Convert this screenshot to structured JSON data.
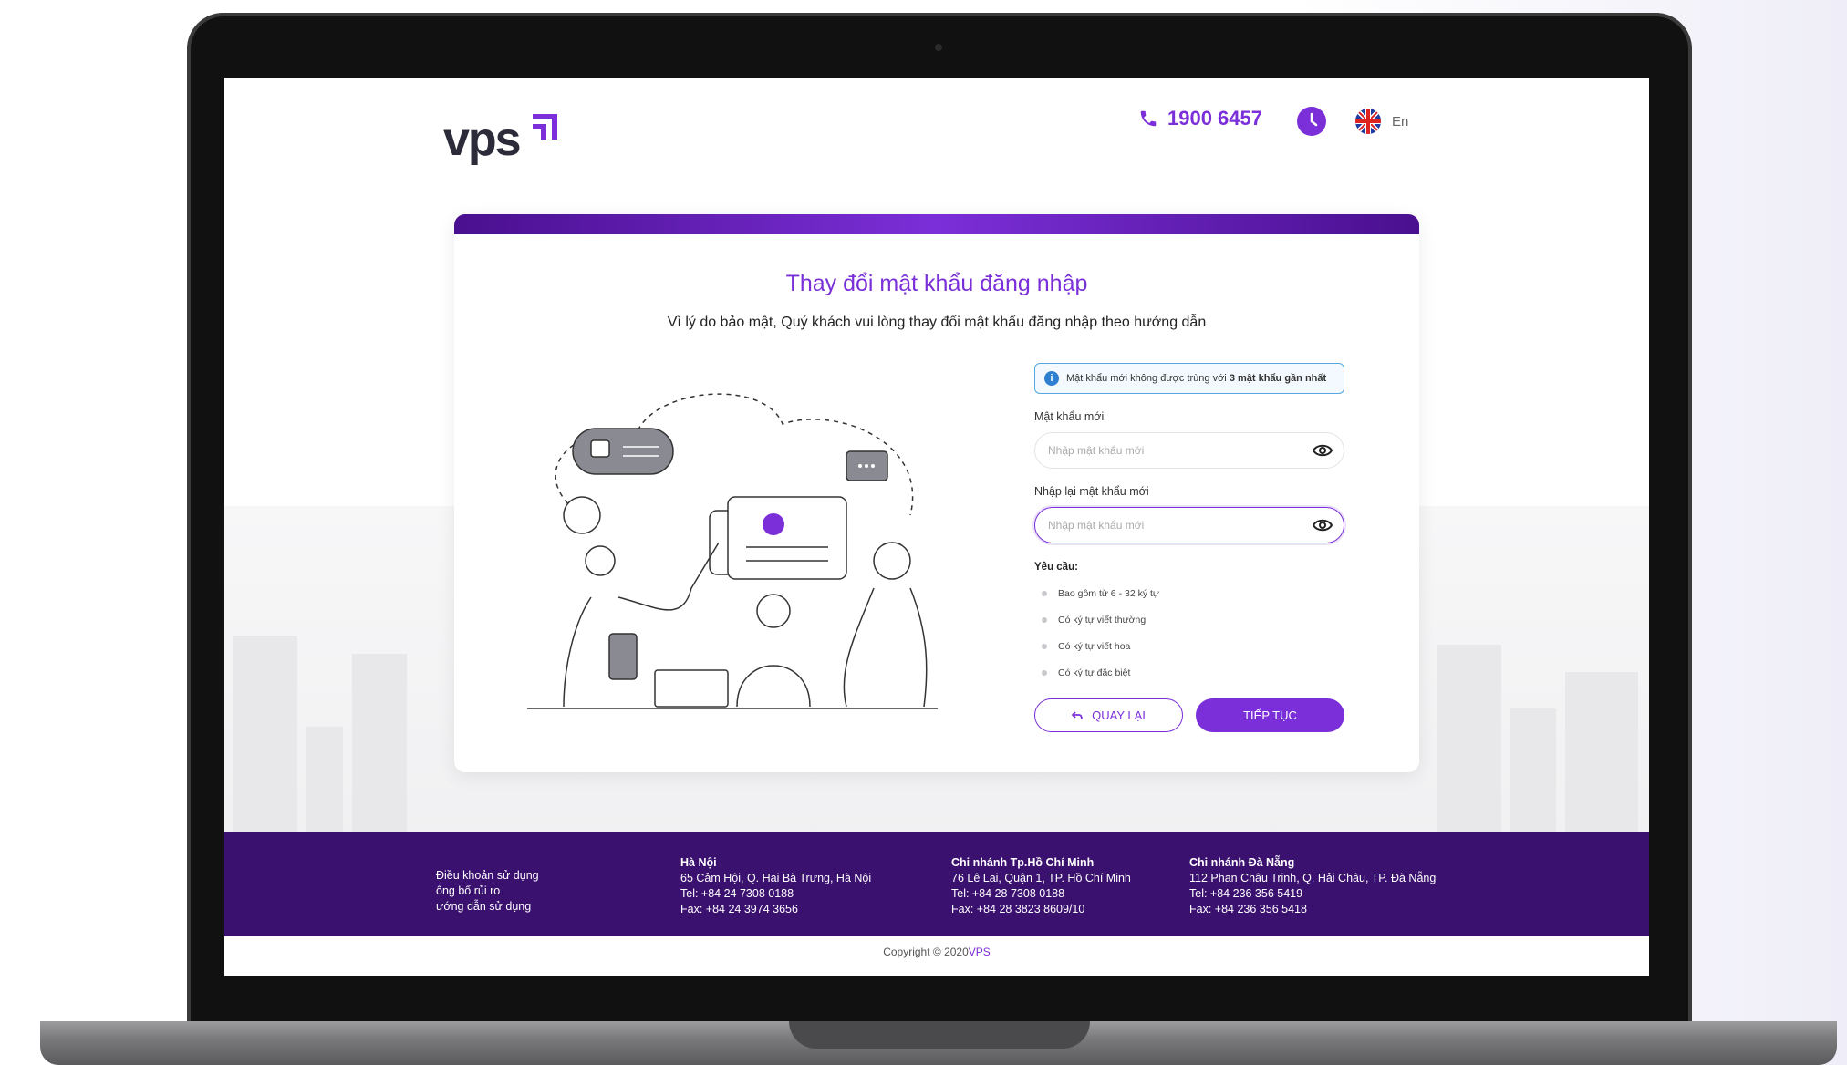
{
  "header": {
    "logo_text": "vps",
    "phone": "1900 6457",
    "language": "En"
  },
  "card": {
    "title": "Thay đổi mật khẩu đăng nhập",
    "subtitle": "Vì lý do bảo mật, Quý khách vui lòng thay đổi mật khẩu đăng nhập theo hướng dẫn",
    "notice_prefix": "Mật khẩu mới không được trùng với ",
    "notice_bold": "3 mật khẩu gần nhất",
    "new_password_label": "Mật khẩu mới",
    "new_password_placeholder": "Nhập mật khẩu mới",
    "confirm_password_label": "Nhập lại mật khẩu mới",
    "confirm_password_placeholder": "Nhập mật khẩu mới",
    "requirements_title": "Yêu cầu:",
    "requirements": [
      "Bao gồm từ 6 - 32 ký tự",
      "Có ký tự viết thường",
      "Có ký tự viết hoa",
      "Có ký tự đặc biệt"
    ],
    "back_button": "QUAY LẠI",
    "next_button": "TIẾP TỤC"
  },
  "footer": {
    "links": [
      "Điều khoản sử dụng",
      "ông bố rủi ro",
      "ướng dẫn sử dụng"
    ],
    "branches": [
      {
        "name": "Hà Nội",
        "address": "65 Cảm Hội, Q. Hai Bà Trưng, Hà Nội",
        "tel": "Tel: +84 24 7308 0188",
        "fax": "Fax: +84 24 3974 3656"
      },
      {
        "name": "Chi nhánh Tp.Hồ Chí Minh",
        "address": "76 Lê Lai, Quận 1, TP. Hồ Chí Minh",
        "tel": "Tel: +84 28 7308 0188",
        "fax": "Fax: +84 28 3823 8609/10"
      },
      {
        "name": "Chi nhánh Đà Nẵng",
        "address": "112 Phan Châu Trinh, Q. Hải Châu, TP. Đà Nẵng",
        "tel": "Tel: +84 236 356 5419",
        "fax": "Fax: +84 236 356 5418"
      }
    ],
    "copyright_prefix": "Copyright © 2020",
    "copyright_brand": "VPS"
  },
  "colors": {
    "accent": "#7b2fd8",
    "footer_bg": "#3b1170",
    "notice_border": "#55a7e0"
  }
}
